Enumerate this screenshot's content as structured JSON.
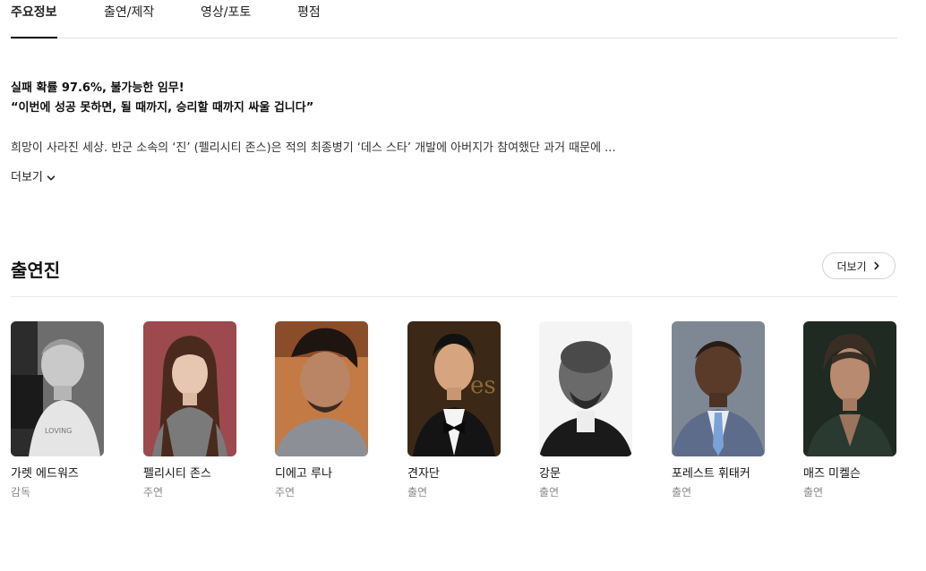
{
  "tabs": [
    {
      "label": "주요정보",
      "active": true
    },
    {
      "label": "출연/제작",
      "active": false
    },
    {
      "label": "영상/포토",
      "active": false
    },
    {
      "label": "평점",
      "active": false
    }
  ],
  "summary": {
    "tagline_line1": "실패 확률 97.6%, 불가능한 임무!",
    "tagline_line2": "“이번에 성공 못하면, 될 때까지, 승리할 때까지 싸울 겁니다”",
    "synopsis": "희망이 사라진 세상. 반군 소속의 ‘진’ (펠리시티 존스)은 적의 최종병기 ‘데스 스타’ 개발에 아버지가 참여했단 과거 때문에 ...",
    "more_label": "더보기",
    "more_icon": "chevron-down-icon"
  },
  "cast": {
    "title": "출연진",
    "more_label": "더보기",
    "more_icon": "chevron-right-icon",
    "members": [
      {
        "name": "가렛 에드워즈",
        "role": "감독"
      },
      {
        "name": "펠리시티 존스",
        "role": "주연"
      },
      {
        "name": "디에고 루나",
        "role": "주연"
      },
      {
        "name": "견자단",
        "role": "출연"
      },
      {
        "name": "강문",
        "role": "출연"
      },
      {
        "name": "포레스트 휘태커",
        "role": "출연"
      },
      {
        "name": "매즈 미켈슨",
        "role": "출연"
      }
    ]
  },
  "colors": {
    "text": "#111111",
    "muted": "#8a8a8a",
    "divider": "#e3e3e3"
  }
}
